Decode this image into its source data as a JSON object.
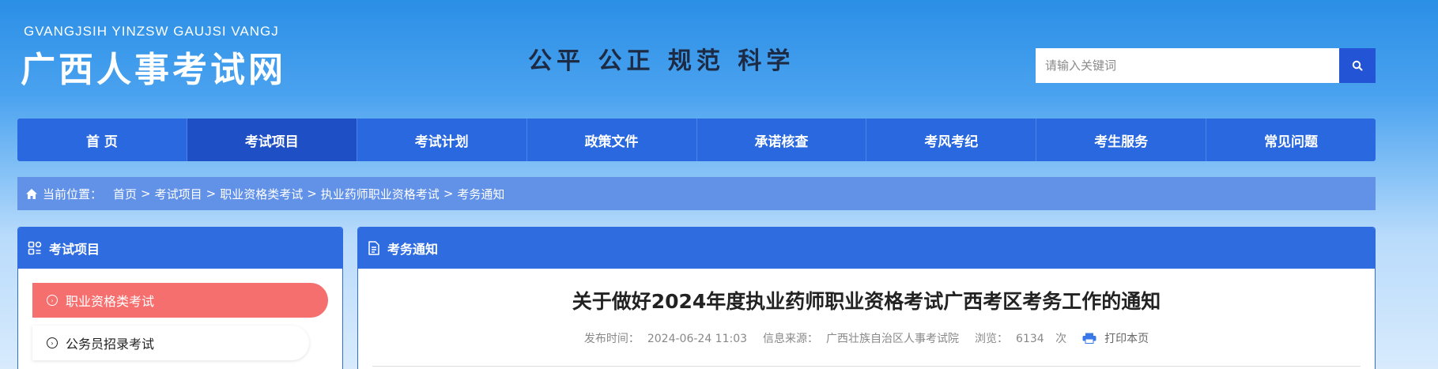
{
  "header": {
    "logo_sub": "GVANGJSIH YINZSW GAUJSI VANGJ",
    "logo_main": "广西人事考试网",
    "slogan": "公平 公正 规范 科学",
    "search_placeholder": "请输入关键词"
  },
  "nav": {
    "items": [
      {
        "label": "首 页"
      },
      {
        "label": "考试项目"
      },
      {
        "label": "考试计划"
      },
      {
        "label": "政策文件"
      },
      {
        "label": "承诺核查"
      },
      {
        "label": "考风考纪"
      },
      {
        "label": "考生服务"
      },
      {
        "label": "常见问题"
      }
    ]
  },
  "breadcrumb": {
    "label": "当前位置：",
    "items": [
      "首页",
      "考试项目",
      "职业资格类考试",
      "执业药师职业资格考试",
      "考务通知"
    ],
    "separator": ">"
  },
  "left_panel": {
    "title": "考试项目",
    "items": [
      {
        "label": "职业资格类考试"
      },
      {
        "label": "公务员招录考试"
      }
    ]
  },
  "right_panel": {
    "title": "考务通知"
  },
  "article": {
    "title": "关于做好2024年度执业药师职业资格考试广西考区考务工作的通知",
    "publish_label": "发布时间：",
    "publish_time": "2024-06-24 11:03",
    "source_label": "信息来源：",
    "source": "广西壮族自治区人事考试院",
    "views_label": "浏览：",
    "views": "6134",
    "views_unit": "次",
    "print_label": "打印本页"
  },
  "colors": {
    "nav_bg": "#2a68e0",
    "nav_active": "#1f4fc4",
    "breadcrumb_bg": "#6291e8",
    "panel_head": "#2f6ce0",
    "menu_active": "#f56f6f",
    "search_button": "#2454d6"
  }
}
